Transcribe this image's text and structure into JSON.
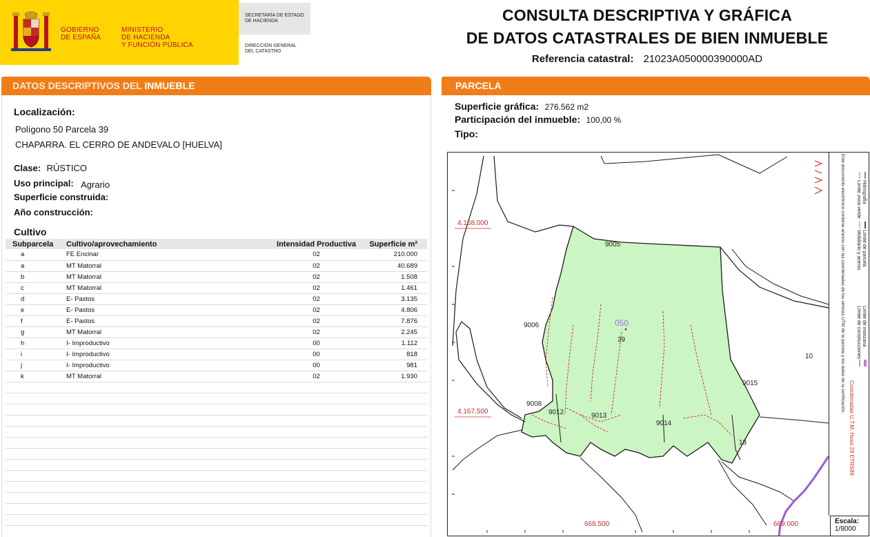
{
  "header": {
    "gobierno_line1": "GOBIERNO",
    "gobierno_line2": "DE ESPAÑA",
    "ministerio_line1": "MINISTERIO",
    "ministerio_line2": "DE HACIENDA",
    "ministerio_line3": "Y FUNCIÓN PÚBLICA",
    "secretaria_line1": "SECRETARÍA DE ESTADO",
    "secretaria_line2": "DE HACIENDA",
    "direccion_line1": "DIRECCIÓN GENERAL",
    "direccion_line2": "DEL CATASTRO",
    "title_line1": "CONSULTA DESCRIPTIVA Y GRÁFICA",
    "title_line2": "DE DATOS CATASTRALES DE BIEN INMUEBLE",
    "ref_label": "Referencia catastral:",
    "ref_value": "21023A050000390000AD"
  },
  "left": {
    "section_title_a": "DATOS DESCRIPTIVOS DEL ",
    "section_title_b": "INMUEBLE",
    "localizacion_label": "Localización:",
    "localizacion_line1": "Polígono 50 Parcela 39",
    "localizacion_line2": "CHAPARRA. EL CERRO DE ANDEVALO [HUELVA]",
    "clase_label": "Clase:",
    "clase_value": "RÚSTICO",
    "uso_label": "Uso principal:",
    "uso_value": "Agrario",
    "superficie_label": "Superficie construida:",
    "anio_label": "Año construcción:",
    "cultivo_label": "Cultivo"
  },
  "table": {
    "headers": [
      "Subparcela",
      "Cultivo/aprovechamiento",
      "Intensidad Productiva",
      "Superficie m²"
    ],
    "rows": [
      [
        "a",
        "FE Encinar",
        "02",
        "210.000"
      ],
      [
        "a",
        "MT Matorral",
        "02",
        "40.689"
      ],
      [
        "b",
        "MT Matorral",
        "02",
        "1.508"
      ],
      [
        "c",
        "MT Matorral",
        "02",
        "1.461"
      ],
      [
        "d",
        "E- Pastos",
        "02",
        "3.135"
      ],
      [
        "e",
        "E- Pastos",
        "02",
        "4.806"
      ],
      [
        "f",
        "E- Pastos",
        "02",
        "7.876"
      ],
      [
        "g",
        "MT Matorral",
        "02",
        "2.245"
      ],
      [
        "h",
        "I- Improductivo",
        "00",
        "1.112"
      ],
      [
        "i",
        "I- Improductivo",
        "00",
        "818"
      ],
      [
        "j",
        "I- Improductivo",
        "00",
        "981"
      ],
      [
        "k",
        "MT Matorral",
        "02",
        "1.930"
      ]
    ]
  },
  "right": {
    "section_title": "PARCELA",
    "sup_grafica_label": "Superficie gráfica:",
    "sup_grafica_value": "276.562 m2",
    "participacion_label": "Participación del inmueble:",
    "participacion_value": "100,00 %",
    "tipo_label": "Tipo:"
  },
  "map": {
    "coord_y1": "4.168.000",
    "coord_y2": "4.167.500",
    "coord_x1": "668.500",
    "coord_x2": "669.000",
    "poly_label": "050",
    "parcel_label": "39",
    "labels": [
      "9005",
      "9006",
      "9008",
      "9012",
      "9013",
      "9014",
      "9015",
      "10",
      "13"
    ],
    "north_label": "N",
    "legend_limite_parcela": "Límite de parcela",
    "legend_hidrografia": "Hidrografía",
    "legend_mobiliario": "Mobiliario y aceras",
    "legend_zona_verde": "Límite zona verde",
    "legend_manzana": "Límite de manzana",
    "legend_construcciones": "Límite de construcciones",
    "legend_coords": "Coordenadas U.T.M. Huso 29 ETRS89",
    "legend_note": "Este documento electrónico contiene anexos con las coordenadas de los vértices UTM de la parcela y los datos de la certificación.",
    "escala_label": "Escala:",
    "escala_value": "1/8000",
    "colors": {
      "parcel_fill": "#ccf5c4",
      "contour": "#d22020",
      "boundary": "#1a1a1a",
      "hydro": "#9b59d6",
      "label_poly": "#9a72d6"
    }
  }
}
